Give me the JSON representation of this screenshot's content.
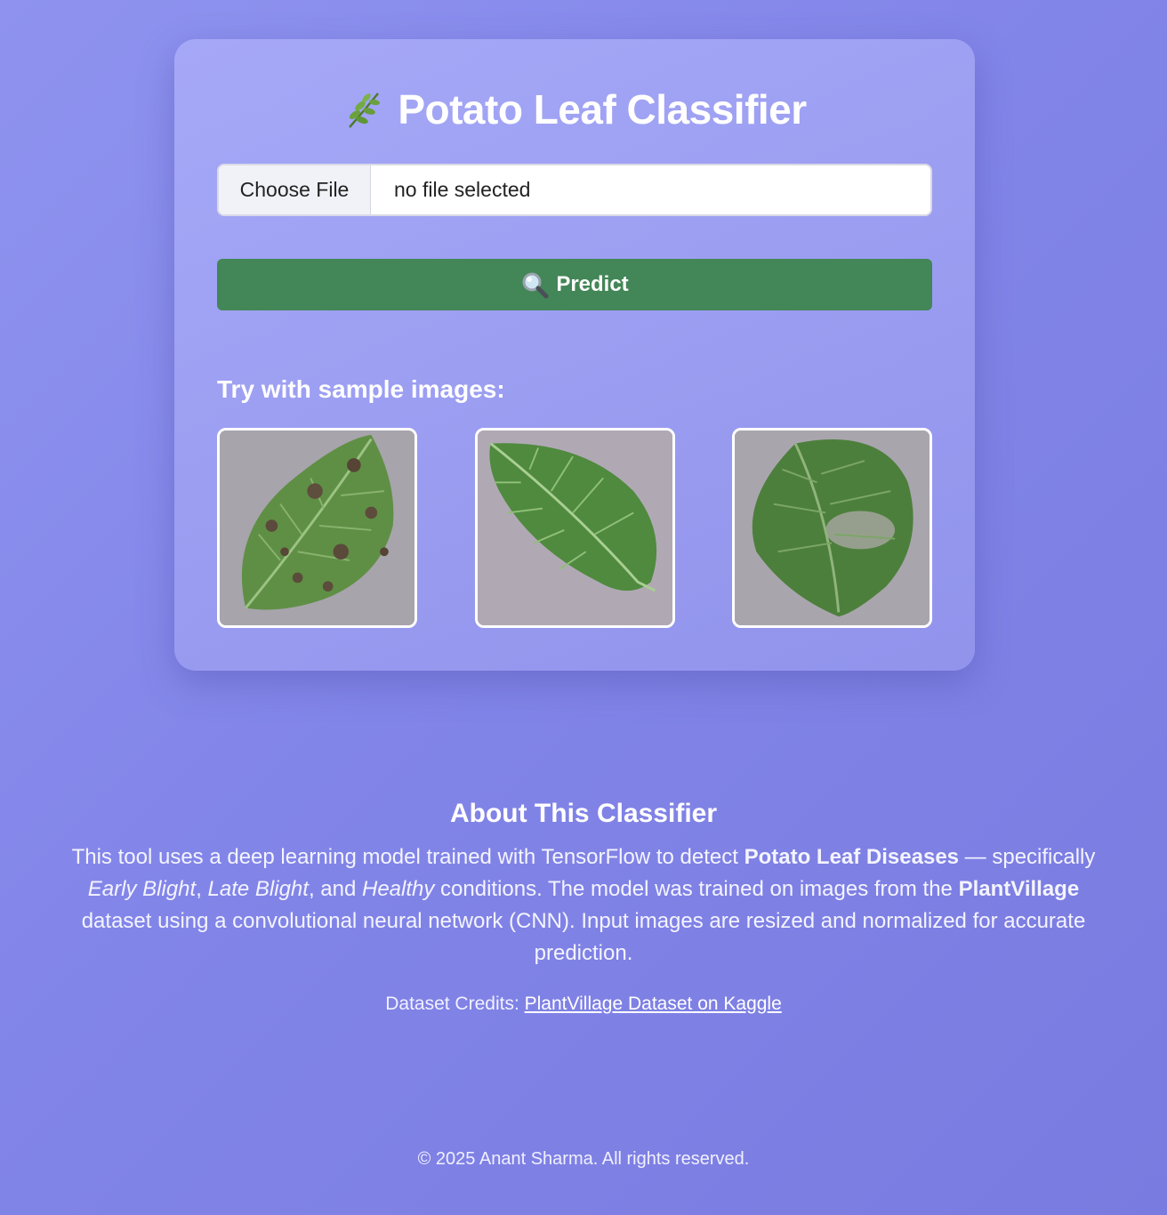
{
  "app": {
    "title": "Potato Leaf Classifier",
    "title_icon": "herb-icon"
  },
  "upload": {
    "choose_file_label": "Choose File",
    "file_status": "no file selected"
  },
  "predict": {
    "label": "Predict",
    "icon": "magnifying-glass-icon",
    "color": "#438657"
  },
  "samples": {
    "heading": "Try with sample images:",
    "images": [
      {
        "icon": "leaf-spotted-image"
      },
      {
        "icon": "leaf-healthy-image"
      },
      {
        "icon": "leaf-blight-patch-image"
      }
    ]
  },
  "about": {
    "title": "About This Classifier",
    "p1": "This tool uses a deep learning model trained with TensorFlow to detect ",
    "b1": "Potato Leaf Diseases",
    "p2": " — specifically ",
    "i1": "Early Blight",
    "p3": ", ",
    "i2": "Late Blight",
    "p4": ", and ",
    "i3": "Healthy",
    "p5": " conditions. The model was trained on images from the ",
    "b2": "PlantVillage",
    "p6": " dataset using a convolutional neural network (CNN). Input images are resized and normalized for accurate prediction."
  },
  "credits": {
    "label": "Dataset Credits: ",
    "link_text": "PlantVillage Dataset on Kaggle"
  },
  "footer": {
    "text": "© 2025 Anant Sharma. All rights reserved."
  },
  "colors": {
    "background": "#8285e8",
    "card": "#a0a2f2",
    "text": "#ffffff"
  }
}
